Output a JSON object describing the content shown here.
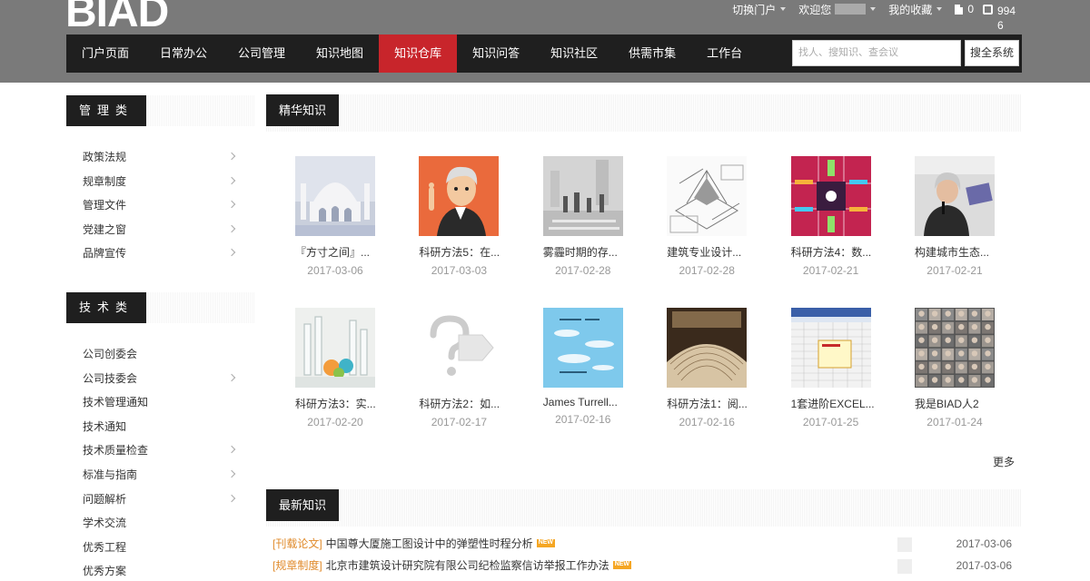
{
  "header": {
    "logo": "BIAD",
    "switch_portal": "切换门户",
    "welcome": "欢迎您",
    "favorites": "我的收藏",
    "doc_count": "0",
    "edit_count": "9946"
  },
  "nav": {
    "items": [
      "门户页面",
      "日常办公",
      "公司管理",
      "知识地图",
      "知识仓库",
      "知识问答",
      "知识社区",
      "供需市集",
      "工作台"
    ],
    "active_index": 4,
    "search_placeholder": "找人、搜知识、查会议",
    "search_button": "搜全系统"
  },
  "sidebar": {
    "management": {
      "title": "管理类",
      "items": [
        {
          "label": "政策法规",
          "arrow": true
        },
        {
          "label": "规章制度",
          "arrow": true
        },
        {
          "label": "管理文件",
          "arrow": true
        },
        {
          "label": "党建之窗",
          "arrow": true
        },
        {
          "label": "品牌宣传",
          "arrow": true
        }
      ]
    },
    "tech": {
      "title": "技术类",
      "items": [
        {
          "label": "公司创委会",
          "arrow": false
        },
        {
          "label": "公司技委会",
          "arrow": true
        },
        {
          "label": "技术管理通知",
          "arrow": false
        },
        {
          "label": "技术通知",
          "arrow": false
        },
        {
          "label": "技术质量检查",
          "arrow": true
        },
        {
          "label": "标准与指南",
          "arrow": true
        },
        {
          "label": "问题解析",
          "arrow": true
        },
        {
          "label": "学术交流",
          "arrow": false
        },
        {
          "label": "优秀工程",
          "arrow": false
        },
        {
          "label": "优秀方案",
          "arrow": false
        }
      ]
    }
  },
  "featured": {
    "title": "精华知识",
    "more": "更多",
    "cards": [
      {
        "title": "『方寸之间』...",
        "date": "2017-03-06",
        "thumb": "mosque"
      },
      {
        "title": "科研方法5：在...",
        "date": "2017-03-03",
        "thumb": "cartoon"
      },
      {
        "title": "雾霾时期的存...",
        "date": "2017-02-28",
        "thumb": "fog"
      },
      {
        "title": "建筑专业设计...",
        "date": "2017-02-28",
        "thumb": "drawing"
      },
      {
        "title": "科研方法4：数...",
        "date": "2017-02-21",
        "thumb": "data"
      },
      {
        "title": "构建城市生态...",
        "date": "2017-02-21",
        "thumb": "speaker"
      },
      {
        "title": "科研方法3：实...",
        "date": "2017-02-20",
        "thumb": "lab"
      },
      {
        "title": "科研方法2：如...",
        "date": "2017-02-17",
        "thumb": "question"
      },
      {
        "title": "James Turrell...",
        "date": "2017-02-16",
        "thumb": "sky"
      },
      {
        "title": "科研方法1：阅...",
        "date": "2017-02-16",
        "thumb": "books"
      },
      {
        "title": "1套进阶EXCEL...",
        "date": "2017-01-25",
        "thumb": "excel"
      },
      {
        "title": "我是BIAD人2",
        "date": "2017-01-24",
        "thumb": "faces"
      }
    ]
  },
  "latest": {
    "title": "最新知识",
    "badge": "NEW",
    "items": [
      {
        "category": "[刊载论文]",
        "title": "中国尊大厦施工图设计中的弹塑性时程分析",
        "date": "2017-03-06"
      },
      {
        "category": "[规章制度]",
        "title": "北京市建筑设计研究院有限公司纪检监察信访举报工作办法",
        "date": "2017-03-06"
      }
    ]
  }
}
